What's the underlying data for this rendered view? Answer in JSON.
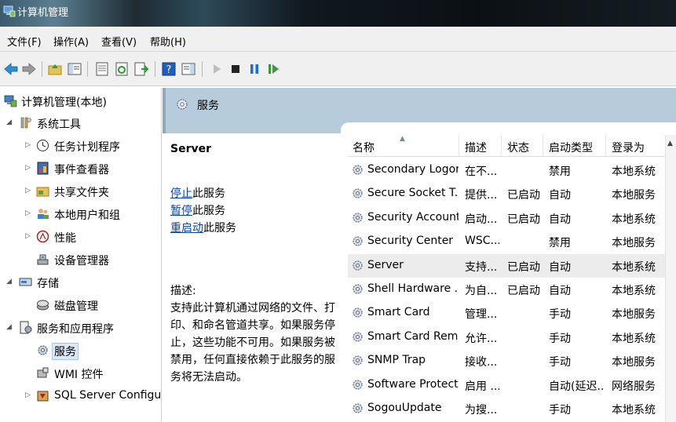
{
  "window": {
    "title": "计算机管理"
  },
  "menu": [
    "文件(F)",
    "操作(A)",
    "查看(V)",
    "帮助(H)"
  ],
  "tree": {
    "root": "计算机管理(本地)",
    "system_tools": "系统工具",
    "task_scheduler": "任务计划程序",
    "event_viewer": "事件查看器",
    "shared_folders": "共享文件夹",
    "local_users": "本地用户和组",
    "performance": "性能",
    "device_manager": "设备管理器",
    "storage": "存储",
    "disk_mgmt": "磁盘管理",
    "services_apps": "服务和应用程序",
    "services": "服务",
    "wmi": "WMI 控件",
    "sql": "SQL Server Configura"
  },
  "header": {
    "title": "服务"
  },
  "detail": {
    "service_name": "Server",
    "stop_link": "停止",
    "stop_rest": "此服务",
    "pause_link": "暂停",
    "pause_rest": "此服务",
    "restart_link": "重启动",
    "restart_rest": "此服务",
    "desc_label": "描述:",
    "desc_text": "支持此计算机通过网络的文件、打印、和命名管道共享。如果服务停止，这些功能不可用。如果服务被禁用，任何直接依赖于此服务的服务将无法启动。"
  },
  "table": {
    "columns": [
      "名称",
      "描述",
      "状态",
      "启动类型",
      "登录为"
    ],
    "rows": [
      [
        "Secondary Logon",
        "在不...",
        "",
        "禁用",
        "本地系统"
      ],
      [
        "Secure Socket T...",
        "提供...",
        "已启动",
        "自动",
        "本地服务"
      ],
      [
        "Security Account...",
        "启动...",
        "已启动",
        "自动",
        "本地系统"
      ],
      [
        "Security Center",
        "WSC...",
        "",
        "禁用",
        "本地服务"
      ],
      [
        "Server",
        "支持...",
        "已启动",
        "自动",
        "本地系统"
      ],
      [
        "Shell Hardware ...",
        "为自...",
        "已启动",
        "自动",
        "本地系统"
      ],
      [
        "Smart Card",
        "管理...",
        "",
        "手动",
        "本地服务"
      ],
      [
        "Smart Card Rem...",
        "允许...",
        "",
        "手动",
        "本地系统"
      ],
      [
        "SNMP Trap",
        "接收...",
        "",
        "手动",
        "本地服务"
      ],
      [
        "Software Protect...",
        "启用 ...",
        "",
        "自动(延迟...",
        "网络服务"
      ],
      [
        "SogouUpdate",
        "为搜...",
        "",
        "手动",
        "本地系统"
      ]
    ],
    "selected_index": 4
  },
  "colors": {
    "header_bg": "#b6ccdc",
    "selected_row": "#ececec",
    "link": "#0645ad"
  }
}
